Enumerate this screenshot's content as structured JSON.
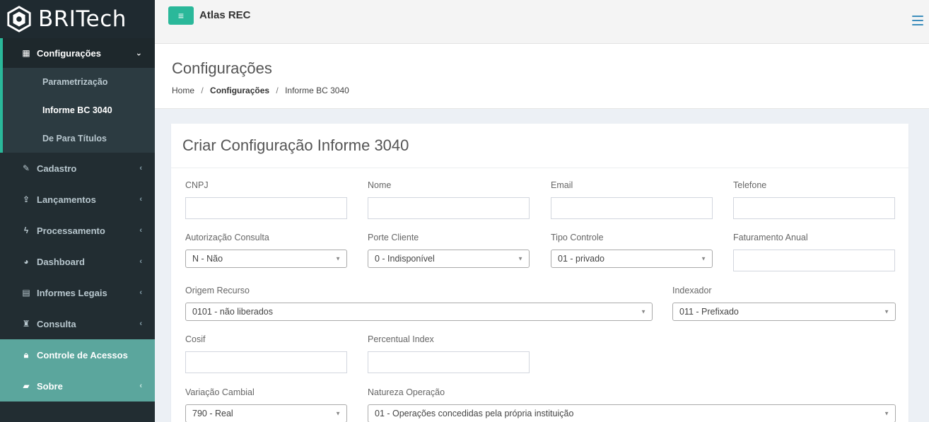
{
  "logo": {
    "text": "BRITech"
  },
  "header": {
    "app_title": "Atlas REC",
    "toggle_label": "≡"
  },
  "sidebar": {
    "open_item": {
      "label": "Configurações",
      "chevron": "⌄"
    },
    "sub_items": [
      {
        "label": "Parametrização"
      },
      {
        "label": "Informe BC 3040"
      },
      {
        "label": "De Para Títulos"
      }
    ],
    "items": [
      {
        "label": "Cadastro",
        "icon": "edit-icon"
      },
      {
        "label": "Lançamentos",
        "icon": "upload-icon"
      },
      {
        "label": "Processamento",
        "icon": "bolt-icon"
      },
      {
        "label": "Dashboard",
        "icon": "pie-chart-icon"
      },
      {
        "label": "Informes Legais",
        "icon": "file-icon"
      },
      {
        "label": "Consulta",
        "icon": "binoculars-icon"
      },
      {
        "label": "Controle de Acessos",
        "icon": "lock-icon"
      },
      {
        "label": "Sobre",
        "icon": "book-icon"
      }
    ],
    "chevron": "‹"
  },
  "page": {
    "title": "Configurações",
    "breadcrumb": [
      "Home",
      "Configurações",
      "Informe BC 3040"
    ],
    "breadcrumb_sep": "/"
  },
  "form": {
    "title": "Criar Configuração Informe 3040",
    "fields": {
      "cnpj": {
        "label": "CNPJ",
        "value": ""
      },
      "nome": {
        "label": "Nome",
        "value": ""
      },
      "email": {
        "label": "Email",
        "value": ""
      },
      "telefone": {
        "label": "Telefone",
        "value": ""
      },
      "autorizacao_consulta": {
        "label": "Autorização Consulta",
        "value": "N - Não"
      },
      "porte_cliente": {
        "label": "Porte Cliente",
        "value": "0 - Indisponível"
      },
      "tipo_controle": {
        "label": "Tipo Controle",
        "value": "01 - privado"
      },
      "faturamento_anual": {
        "label": "Faturamento Anual",
        "value": ""
      },
      "origem_recurso": {
        "label": "Origem Recurso",
        "value": "0101 - não liberados"
      },
      "indexador": {
        "label": "Indexador",
        "value": "011 - Prefixado"
      },
      "cosif": {
        "label": "Cosif",
        "value": ""
      },
      "percentual_index": {
        "label": "Percentual Index",
        "value": ""
      },
      "variacao_cambial": {
        "label": "Variação Cambial",
        "value": "790 - Real"
      },
      "natureza_operacao": {
        "label": "Natureza Operação",
        "value": "01 - Operações concedidas pela própria instituição"
      }
    }
  },
  "colors": {
    "accent": "#2ab89a",
    "sidebar_bg": "#222d32",
    "highlight": "#5ba69d"
  }
}
